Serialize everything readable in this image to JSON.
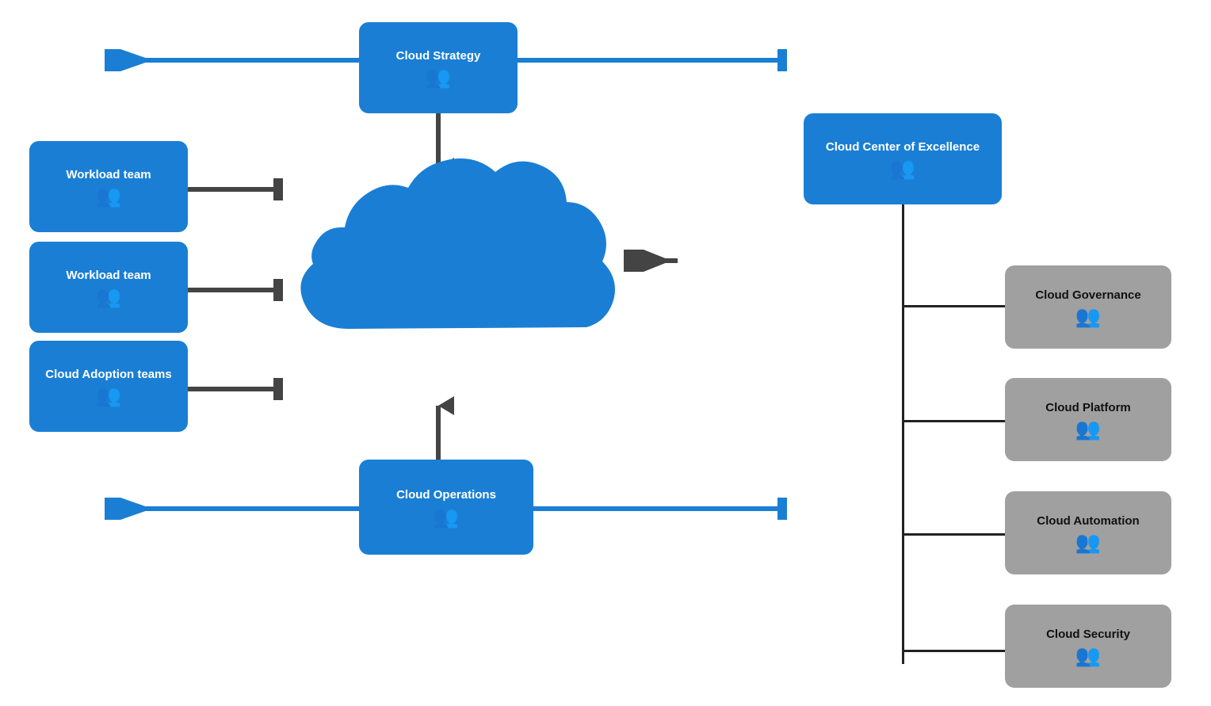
{
  "boxes": {
    "cloud_strategy": {
      "label": "Cloud Strategy",
      "type": "blue"
    },
    "workload_team_1": {
      "label": "Workload team",
      "type": "blue"
    },
    "workload_team_2": {
      "label": "Workload team",
      "type": "blue"
    },
    "cloud_adoption": {
      "label": "Cloud Adoption teams",
      "type": "blue"
    },
    "cloud_ops": {
      "label": "Cloud Operations",
      "type": "blue"
    },
    "ccoe": {
      "label": "Cloud Center of Excellence",
      "type": "blue"
    },
    "cloud_governance": {
      "label": "Cloud Governance",
      "type": "gray"
    },
    "cloud_platform": {
      "label": "Cloud Platform",
      "type": "gray"
    },
    "cloud_automation": {
      "label": "Cloud Automation",
      "type": "gray"
    },
    "cloud_security": {
      "label": "Cloud Security",
      "type": "gray"
    }
  },
  "icon": "&#128101;",
  "colors": {
    "blue": "#1a7fd4",
    "gray": "#a0a0a0",
    "dark": "#333",
    "arrow_blue": "#1a7fd4",
    "arrow_dark": "#444"
  }
}
